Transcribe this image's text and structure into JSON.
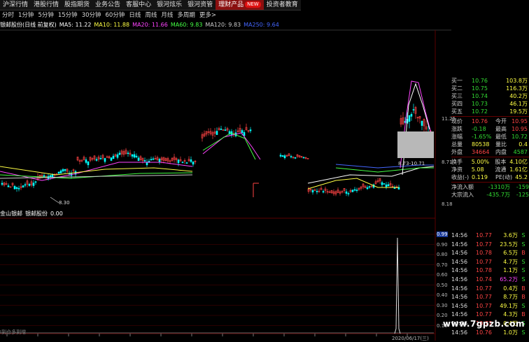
{
  "top_menu": {
    "items": [
      "沪深行情",
      "港股行情",
      "股指期货",
      "业务公告",
      "客服中心",
      "银河炫乐",
      "银河资管",
      "理财产品",
      "投资者教育"
    ],
    "highlighted_index": 7,
    "new_badge": "NEW"
  },
  "period_tabs": [
    "分时",
    "1分钟",
    "5分钟",
    "15分钟",
    "30分钟",
    "60分钟",
    "日线",
    "周线",
    "月线",
    "多周期",
    "更多>"
  ],
  "ma_bar": {
    "title": "银邮股份(日线 前复权)",
    "items": [
      {
        "text": "MA5: 11.22",
        "color": "#ffffff"
      },
      {
        "text": "MA10: 11.88",
        "color": "#ffff44"
      },
      {
        "text": "MA20: 11.66",
        "color": "#ff44ff"
      },
      {
        "text": "MA60: 9.83",
        "color": "#44ff44"
      },
      {
        "text": "MA120: 9.83",
        "color": "#cccccc"
      },
      {
        "text": "MA250: 9.64",
        "color": "#4466ff"
      }
    ]
  },
  "price_axis": [
    "11.25",
    "8.71",
    "8.18"
  ],
  "chart_labels": {
    "low": "8.30",
    "range": "8.73-10.71"
  },
  "indicator_bar": {
    "items": [
      {
        "text": "金山银邮",
        "color": "#ffffff"
      },
      {
        "text": "银邮股份",
        "color": "#ffffff"
      },
      {
        "text": "0.00",
        "color": "#ffffff"
      }
    ]
  },
  "indicator_axis": [
    "0.99",
    "0.90",
    "0.80",
    "0.70",
    "0.60",
    "0.50",
    "0.40",
    "0.30",
    "0.20",
    "0.10"
  ],
  "bottom_text": "I到仓多到增",
  "bottom_date": "2020/06/17(三)",
  "quote_panel": {
    "bids": [
      {
        "label": "买一",
        "price": "10.76",
        "vol": "103.8万"
      },
      {
        "label": "买二",
        "price": "10.75",
        "vol": "116.3万"
      },
      {
        "label": "买三",
        "price": "10.74",
        "vol": "40.2万"
      },
      {
        "label": "买四",
        "price": "10.73",
        "vol": "46.1万"
      },
      {
        "label": "买五",
        "price": "10.72",
        "vol": "19.5万"
      }
    ],
    "stats": [
      {
        "l1": "现价",
        "v1": "10.76",
        "c1": "#ff4444",
        "l2": "今开",
        "v2": "10.95",
        "c2": "#ff4444"
      },
      {
        "l1": "涨跌",
        "v1": "-0.18",
        "c1": "#33dd33",
        "l2": "最高",
        "v2": "10.95",
        "c2": "#ff4444"
      },
      {
        "l1": "涨幅",
        "v1": "-1.65%",
        "c1": "#33dd33",
        "l2": "最低",
        "v2": "10.72",
        "c2": "#33dd33"
      },
      {
        "l1": "总量",
        "v1": "80538",
        "c1": "#ffff44",
        "l2": "量比",
        "v2": "0.4",
        "c2": "#ffff44"
      },
      {
        "l1": "外盘",
        "v1": "34664",
        "c1": "#ff4444",
        "l2": "内盘",
        "v2": "4587",
        "c2": "#33dd33"
      },
      {
        "l1": "换手",
        "v1": "5.00%",
        "c1": "#ffff44",
        "l2": "股本",
        "v2": "4.10亿",
        "c2": "#ffff44"
      },
      {
        "l1": "净资",
        "v1": "5.08",
        "c1": "#ffff44",
        "l2": "流通",
        "v2": "1.61亿",
        "c2": "#ffff44"
      },
      {
        "l1": "收益(-)",
        "v1": "0.119",
        "c1": "#ffff44",
        "l2": "PE(动)",
        "v2": "45.2",
        "c2": "#ffff44"
      }
    ],
    "flows": [
      {
        "label": "净流入额",
        "value": "-1310万",
        "v2": "-159",
        "color": "#33dd33"
      },
      {
        "label": "大宗流入",
        "value": "-435.7万",
        "v2": "-125",
        "color": "#33dd33"
      }
    ]
  },
  "ticks": [
    {
      "time": "14:56",
      "price": "10.77",
      "vol": "3.6万",
      "side": "S",
      "pc": "#ff4444",
      "vc": "#ffff44",
      "sc": "#33dd33"
    },
    {
      "time": "14:56",
      "price": "10.77",
      "vol": "23.5万",
      "side": "S",
      "pc": "#ff4444",
      "vc": "#ffff44",
      "sc": "#33dd33"
    },
    {
      "time": "14:56",
      "price": "10.78",
      "vol": "6.5万",
      "side": "B",
      "pc": "#ff4444",
      "vc": "#ffff44",
      "sc": "#ff4444"
    },
    {
      "time": "14:56",
      "price": "10.77",
      "vol": "4.7万",
      "side": "S",
      "pc": "#ff4444",
      "vc": "#ffff44",
      "sc": "#33dd33"
    },
    {
      "time": "14:56",
      "price": "10.78",
      "vol": "1.1万",
      "side": "S",
      "pc": "#ff4444",
      "vc": "#ffff44",
      "sc": "#33dd33"
    },
    {
      "time": "14:56",
      "price": "10.74",
      "vol": "65.2万",
      "side": "S",
      "pc": "#ff4444",
      "vc": "#ff44ff",
      "sc": "#33dd33"
    },
    {
      "time": "14:56",
      "price": "10.77",
      "vol": "0.4万",
      "side": "B",
      "pc": "#ff4444",
      "vc": "#ffff44",
      "sc": "#ff4444"
    },
    {
      "time": "14:56",
      "price": "10.77",
      "vol": "8.7万",
      "side": "B",
      "pc": "#ff4444",
      "vc": "#ffff44",
      "sc": "#ff4444"
    },
    {
      "time": "14:56",
      "price": "10.77",
      "vol": "49.1万",
      "side": "S",
      "pc": "#ff4444",
      "vc": "#ffff44",
      "sc": "#33dd33"
    },
    {
      "time": "14:56",
      "price": "10.77",
      "vol": "4.3万",
      "side": "B",
      "pc": "#ff4444",
      "vc": "#ffff44",
      "sc": "#ff4444"
    },
    {
      "time": "14:56",
      "price": "10.77",
      "vol": "0.4万",
      "side": "S",
      "pc": "#ff4444",
      "vc": "#ffff44",
      "sc": "#33dd33"
    },
    {
      "time": "14:56",
      "price": "10.76",
      "vol": "1.0万",
      "side": "S",
      "pc": "#ff4444",
      "vc": "#ffff44",
      "sc": "#33dd33"
    }
  ],
  "watermark": "www.7gpzb.com",
  "colors": {
    "bg": "#000000",
    "up": "#ff4444",
    "down": "#33dd33",
    "grid": "#5a0000",
    "panel_sep": "#660000"
  }
}
